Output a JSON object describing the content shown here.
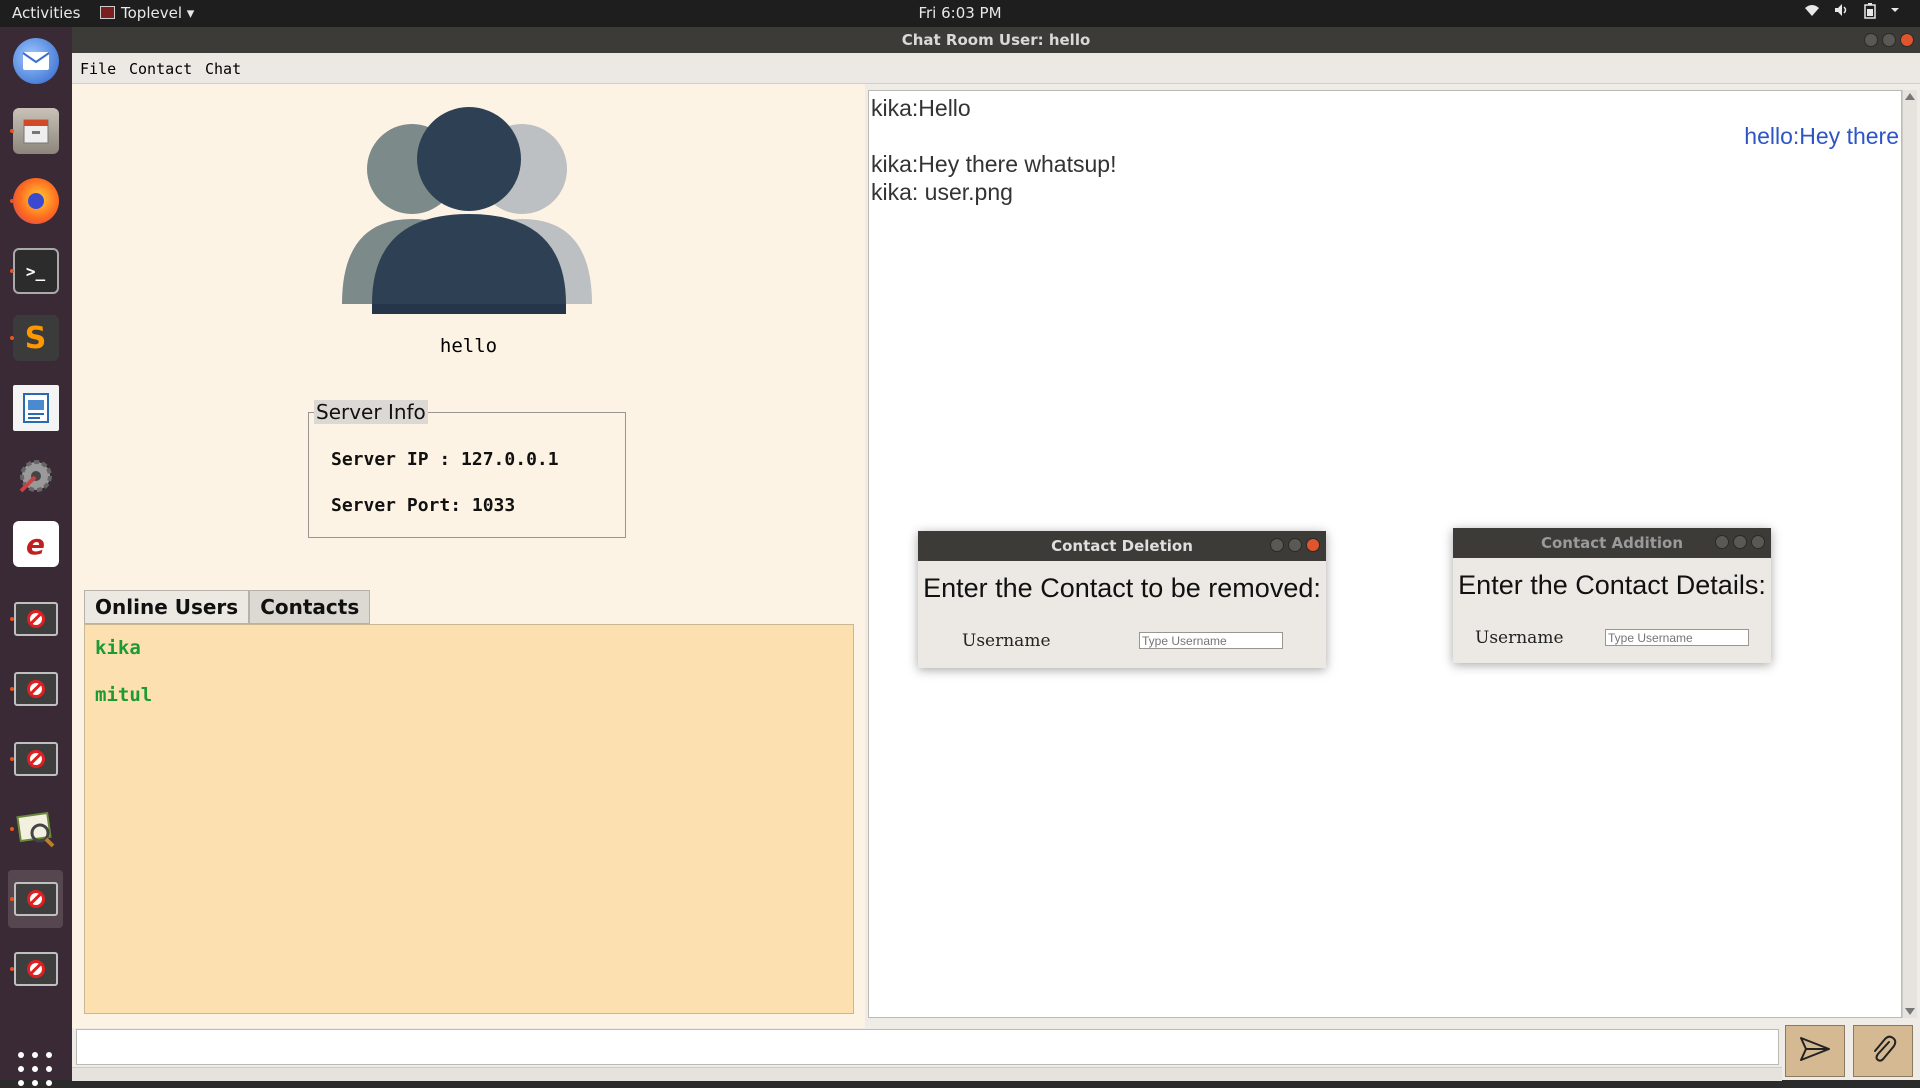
{
  "topbar": {
    "activities": "Activities",
    "app_name": "Toplevel ▾",
    "clock": "Fri  6:03 PM",
    "tray_icons": [
      "wifi-icon",
      "volume-icon",
      "battery-icon",
      "power-menu-icon"
    ]
  },
  "window": {
    "title": "Chat Room User: hello"
  },
  "menu": {
    "file": "File",
    "contact": "Contact",
    "chat": "Chat"
  },
  "profile": {
    "name": "hello"
  },
  "server": {
    "legend": "Server Info",
    "ip": "Server IP : 127.0.0.1",
    "port": "Server Port: 1033"
  },
  "tabs": {
    "online": "Online Users",
    "contacts": "Contacts"
  },
  "users": [
    "kika",
    "mitul"
  ],
  "chat": {
    "messages": [
      {
        "text": "kika:Hello",
        "mine": false
      },
      {
        "text": "hello:Hey there",
        "mine": true
      },
      {
        "text": "kika:Hey there whatsup!",
        "mine": false
      },
      {
        "text": "kika: user.png",
        "mine": false
      }
    ]
  },
  "dialog_delete": {
    "title": "Contact Deletion",
    "prompt": "Enter the Contact to be removed:",
    "label": "Username",
    "placeholder": "Type Username"
  },
  "dialog_add": {
    "title": "Contact Addition",
    "prompt": "Enter the Contact Details:",
    "label": "Username",
    "placeholder": "Type Username"
  },
  "colors": {
    "left_panel": "#fdf3e4",
    "user_list": "#fde0b0",
    "online_user": "#1e9a32",
    "own_message": "#2d55c6",
    "avatar_front": "#2e4054",
    "avatar_back": "#7c8a8a"
  }
}
